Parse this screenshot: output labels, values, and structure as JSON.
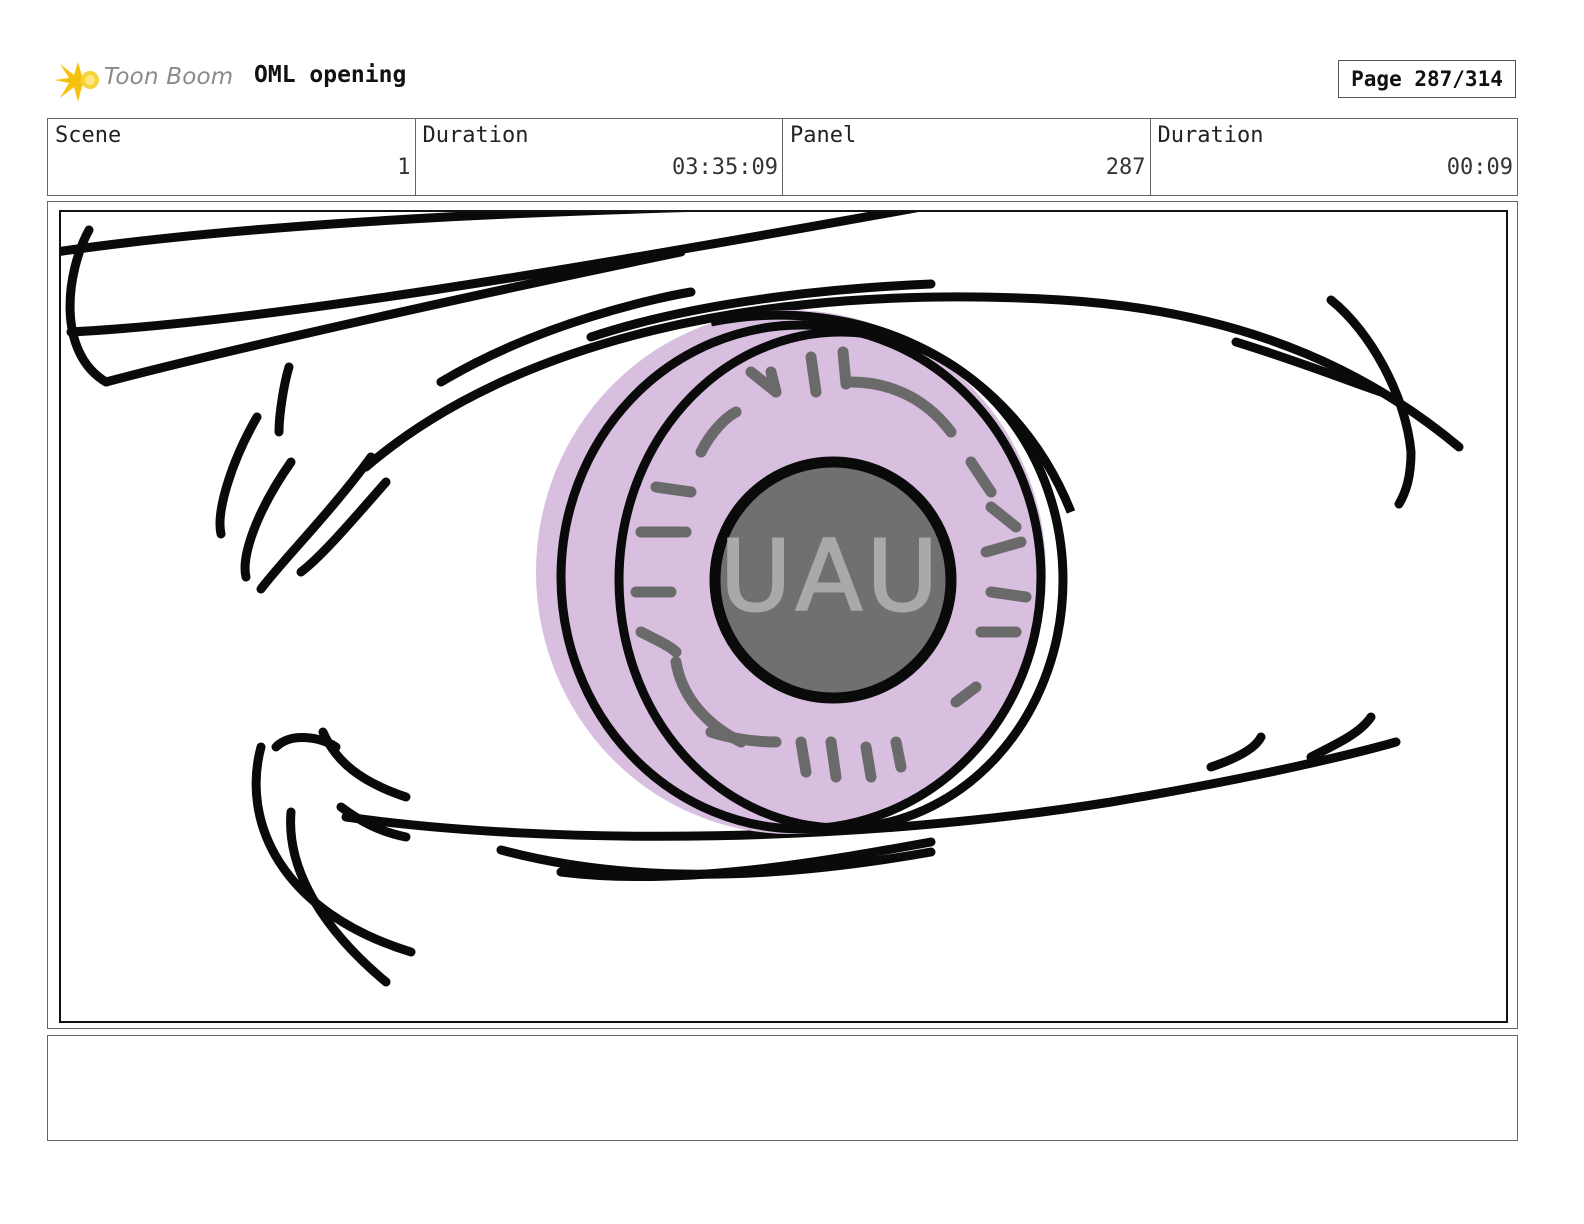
{
  "header": {
    "logo_text": "Toon Boom",
    "project_title": "OML opening",
    "page_indicator": "Page 287/314"
  },
  "info": {
    "scene_label": "Scene",
    "scene_value": "1",
    "scene_duration_label": "Duration",
    "scene_duration_value": "03:35:09",
    "panel_label": "Panel",
    "panel_value": "287",
    "panel_duration_label": "Duration",
    "panel_duration_value": "00:09"
  },
  "panel": {
    "iris_text": "UAU"
  },
  "notes": {
    "text": ""
  }
}
